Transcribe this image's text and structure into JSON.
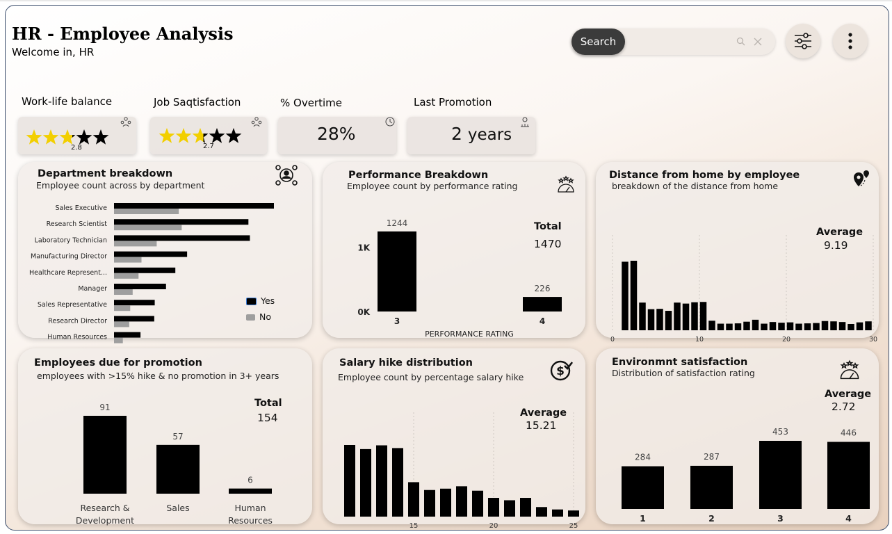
{
  "header": {
    "title": "HR - Employee Analysis",
    "subtitle": "Welcome in, HR",
    "search_label": "Search"
  },
  "colors": {
    "bar": "#000000",
    "bar_secondary": "#9e9e9e",
    "star_filled": "#f2cf00",
    "star_empty": "#000000",
    "search_button": "#3b3b3b"
  },
  "icons": {
    "search": "magnifier-icon",
    "clear": "x-icon",
    "filters": "sliders-icon",
    "more": "vertical-dots-icon",
    "department": "person-network-icon",
    "performance": "rating-gauge-icon",
    "distance": "map-pin-icon",
    "salary": "dollar-check-icon",
    "environment": "rating-gauge-icon"
  },
  "kpis": [
    {
      "label": "Work-life balance",
      "rating": 2.8,
      "rating_text": "2.8",
      "max_stars": 5
    },
    {
      "label": "Job Saqtisfaction",
      "rating": 2.7,
      "rating_text": "2.7",
      "max_stars": 5
    },
    {
      "label": "% Overtime",
      "value": "28%"
    },
    {
      "label": "Last Promotion",
      "value": "2",
      "unit": "years"
    }
  ],
  "panels": {
    "department": {
      "title": "Department breakdown",
      "subtitle": "Employee count across by department"
    },
    "performance": {
      "title": "Performance Breakdown",
      "subtitle": "Employee count by performance rating",
      "total_label": "Total",
      "total_value": "1470"
    },
    "distance": {
      "title": "Distance from home by employee",
      "subtitle": "breakdown of the distance from home",
      "avg_label": "Average",
      "avg_value": "9.19"
    },
    "promotion": {
      "title": "Employees due for promotion",
      "subtitle": "employees with >15% hike & no promotion in 3+ years",
      "total_label": "Total",
      "total_value": "154"
    },
    "salary": {
      "title": "Salary hike distribution",
      "subtitle": "Employee count by percentage salary hike",
      "avg_label": "Average",
      "avg_value": "15.21"
    },
    "environment": {
      "title": "Environmnt satisfaction",
      "subtitle": "Distribution of satisfaction rating",
      "avg_label": "Average",
      "avg_value": "2.72"
    }
  },
  "chart_data": [
    {
      "id": "department",
      "type": "bar",
      "orientation": "horizontal",
      "categories": [
        "Sales Executive",
        "Research Scientist",
        "Laboratory Technician",
        "Manufacturing Director",
        "Healthcare Represent...",
        "Manager",
        "Sales Representative",
        "Research Director",
        "Human Resources"
      ],
      "series": [
        {
          "name": "Yes",
          "values": [
            326,
            274,
            277,
            149,
            125,
            106,
            83,
            82,
            54
          ]
        },
        {
          "name": "No",
          "values": [
            132,
            138,
            87,
            56,
            50,
            38,
            33,
            31,
            18
          ]
        }
      ],
      "legend_position": "right"
    },
    {
      "id": "performance",
      "type": "bar",
      "categories": [
        "3",
        "4"
      ],
      "values": [
        1244,
        226
      ],
      "xlabel": "PERFORMANCE RATING",
      "yticks": [
        "0K",
        "1K"
      ],
      "ylim": [
        0,
        1350
      ]
    },
    {
      "id": "distance",
      "type": "bar",
      "x": [
        1,
        2,
        3,
        4,
        5,
        6,
        7,
        8,
        9,
        10,
        11,
        12,
        13,
        14,
        15,
        16,
        17,
        18,
        19,
        20,
        21,
        22,
        23,
        24,
        25,
        26,
        27,
        28,
        29
      ],
      "values": [
        208,
        211,
        84,
        64,
        65,
        59,
        84,
        81,
        85,
        86,
        29,
        20,
        20,
        21,
        26,
        32,
        20,
        25,
        23,
        24,
        20,
        21,
        22,
        28,
        27,
        25,
        19,
        24,
        27
      ],
      "xticks": [
        "0",
        "10",
        "20",
        "30"
      ],
      "xlim": [
        0,
        30
      ],
      "grid": true
    },
    {
      "id": "promotion",
      "type": "bar",
      "categories": [
        "Research & Development",
        "Sales",
        "Human Resources"
      ],
      "values": [
        91,
        57,
        6
      ]
    },
    {
      "id": "salary",
      "type": "bar",
      "x": [
        11,
        12,
        13,
        14,
        15,
        16,
        17,
        18,
        19,
        20,
        21,
        22,
        23,
        24,
        25
      ],
      "values": [
        210,
        198,
        209,
        201,
        101,
        78,
        82,
        89,
        76,
        55,
        48,
        55,
        28,
        21,
        18
      ],
      "xticks": [
        "15",
        "20",
        "25"
      ],
      "grid": true
    },
    {
      "id": "environment",
      "type": "bar",
      "categories": [
        "1",
        "2",
        "3",
        "4"
      ],
      "values": [
        284,
        287,
        453,
        446
      ]
    }
  ]
}
